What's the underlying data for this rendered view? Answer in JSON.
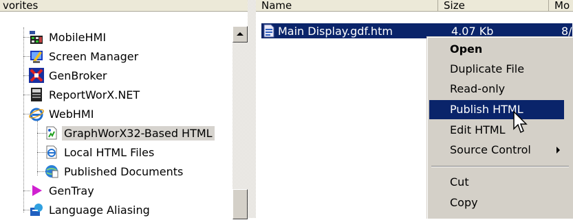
{
  "left_pane": {
    "header": "vorites",
    "tree": [
      {
        "label": "MobileHMI",
        "icon": "mobilehmi-icon"
      },
      {
        "label": "Screen Manager",
        "icon": "screen-manager-icon"
      },
      {
        "label": "GenBroker",
        "icon": "genbroker-icon"
      },
      {
        "label": "ReportWorX.NET",
        "icon": "reportworx-icon"
      },
      {
        "label": "WebHMI",
        "icon": "webhmi-icon"
      },
      {
        "label": "GraphWorX32-Based HTML",
        "icon": "html-document-icon",
        "selected": true
      },
      {
        "label": "Local HTML Files",
        "icon": "local-html-icon"
      },
      {
        "label": "Published Documents",
        "icon": "published-documents-icon"
      },
      {
        "label": "GenTray",
        "icon": "gentray-icon"
      },
      {
        "label": "Language Aliasing",
        "icon": "language-aliasing-icon"
      }
    ]
  },
  "right_pane": {
    "columns": [
      "Name",
      "Size",
      "Mo"
    ],
    "file": {
      "name": "Main Display.gdf.htm",
      "size": "4.07 Kb",
      "date": "8/"
    }
  },
  "context_menu": {
    "items": [
      {
        "label": "Open",
        "bold": true
      },
      {
        "label": "Duplicate File"
      },
      {
        "label": "Read-only"
      },
      {
        "label": "Publish HTML",
        "highlighted": true
      },
      {
        "label": "Edit HTML"
      },
      {
        "label": "Source Control",
        "submenu": true
      },
      {
        "label": "Cut"
      },
      {
        "label": "Copy"
      }
    ]
  },
  "colors": {
    "selection": "#0a246a",
    "menu_bg": "#d4d0c8",
    "tree_selected_bg": "#d6d3ce"
  }
}
